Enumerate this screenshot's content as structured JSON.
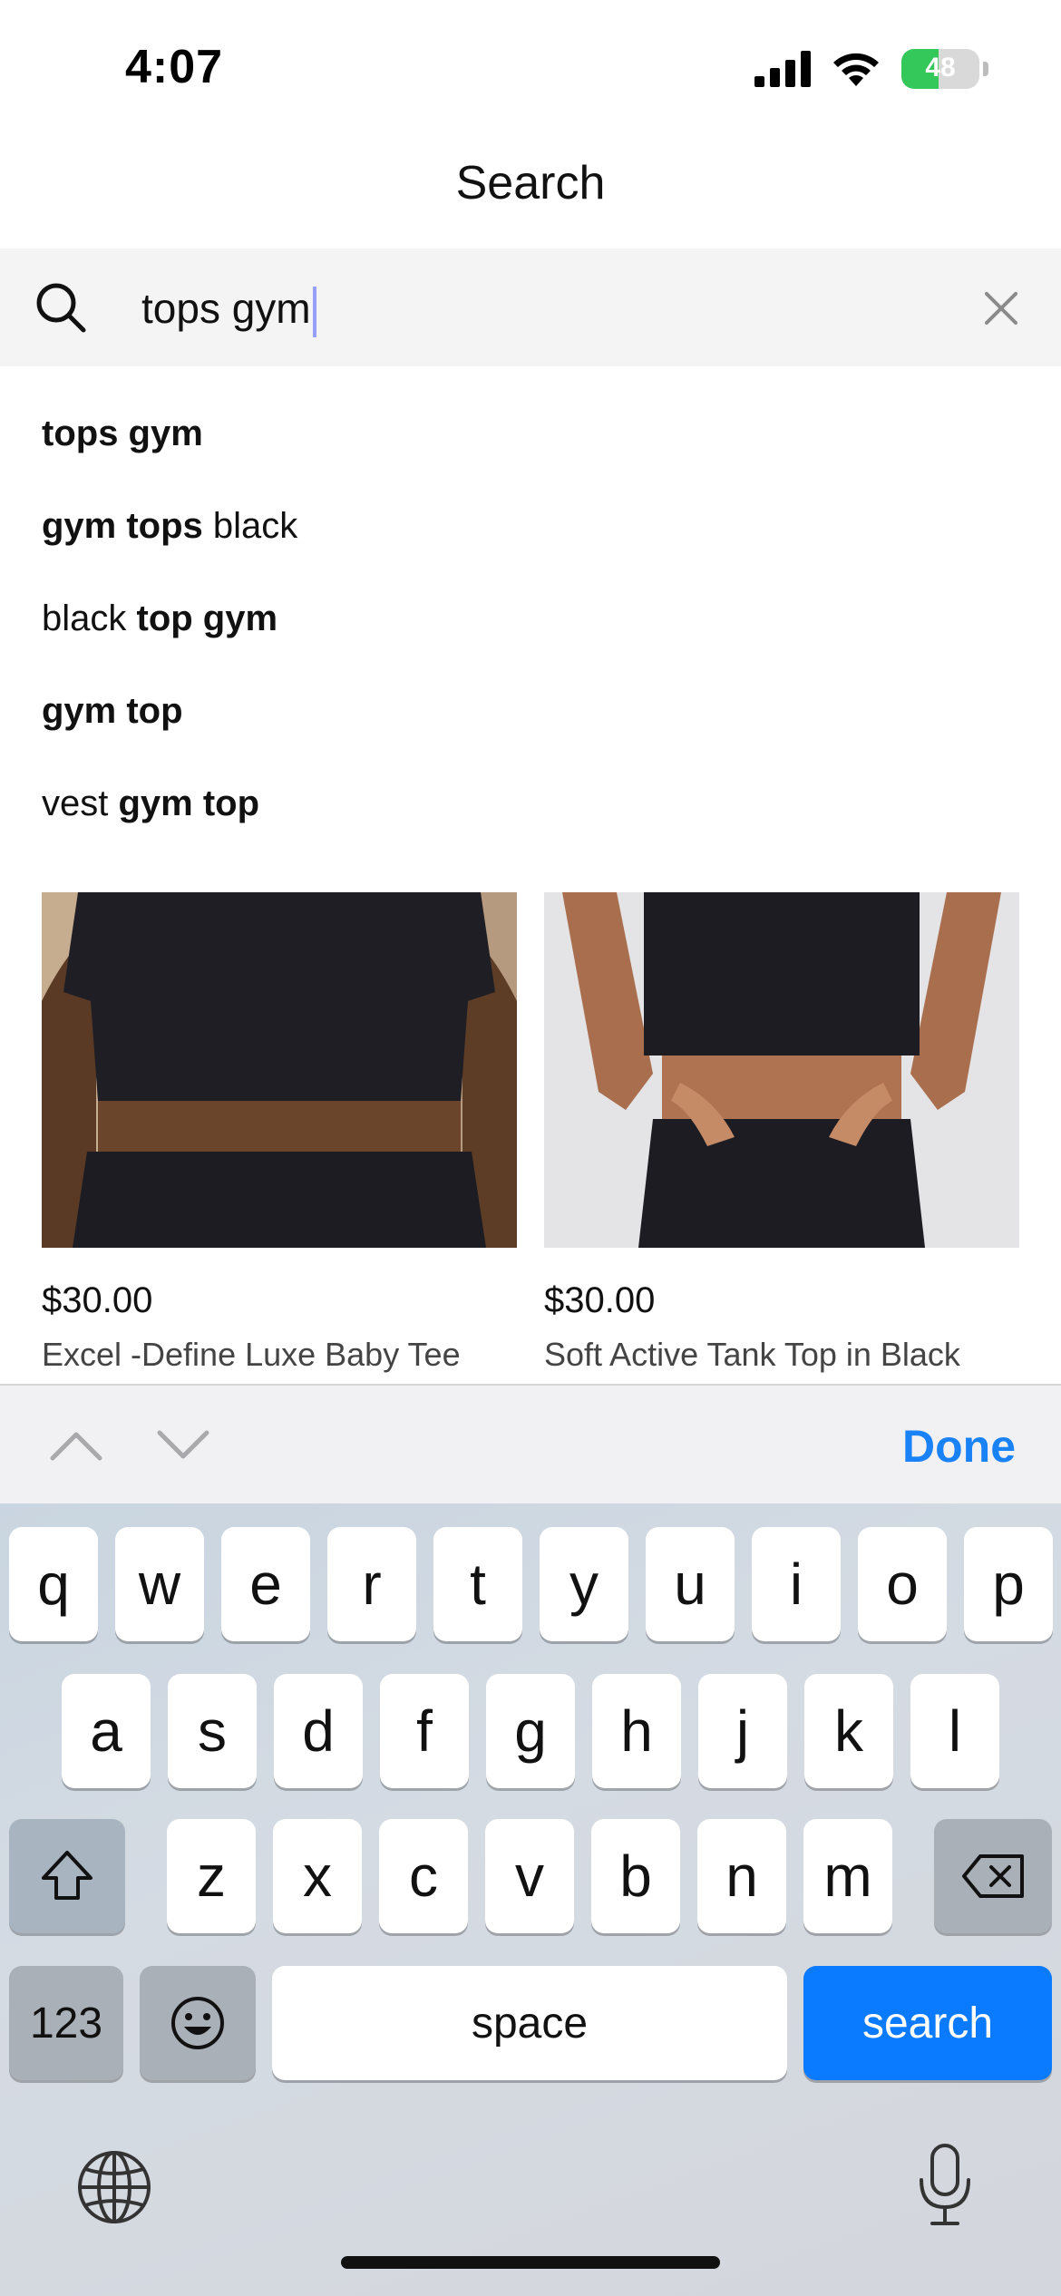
{
  "status_bar": {
    "time": "4:07",
    "battery": "48",
    "battery_level": 0.48
  },
  "header": {
    "title": "Search"
  },
  "search": {
    "value": "tops gym",
    "clear_icon": "close-icon",
    "icon": "search-icon"
  },
  "suggestions": [
    {
      "parts": [
        {
          "text": "tops gym",
          "bold": true
        }
      ]
    },
    {
      "parts": [
        {
          "text": "gym tops",
          "bold": true
        },
        {
          "text": " black",
          "bold": false
        }
      ]
    },
    {
      "parts": [
        {
          "text": "black ",
          "bold": false
        },
        {
          "text": "top gym",
          "bold": true
        }
      ]
    },
    {
      "parts": [
        {
          "text": "gym top",
          "bold": true
        }
      ]
    },
    {
      "parts": [
        {
          "text": "vest ",
          "bold": false
        },
        {
          "text": "gym top",
          "bold": true
        }
      ]
    }
  ],
  "products": [
    {
      "price": "$30.00",
      "name": "Excel -Define Luxe Baby Tee"
    },
    {
      "price": "$30.00",
      "name": "Soft Active Tank Top in Black"
    }
  ],
  "accessory": {
    "done_label": "Done"
  },
  "keyboard": {
    "row1": [
      "q",
      "w",
      "e",
      "r",
      "t",
      "y",
      "u",
      "i",
      "o",
      "p"
    ],
    "row2": [
      "a",
      "s",
      "d",
      "f",
      "g",
      "h",
      "j",
      "k",
      "l"
    ],
    "row3": [
      "z",
      "x",
      "c",
      "v",
      "b",
      "n",
      "m"
    ],
    "numbers_label": "123",
    "space_label": "space",
    "search_label": "search"
  }
}
